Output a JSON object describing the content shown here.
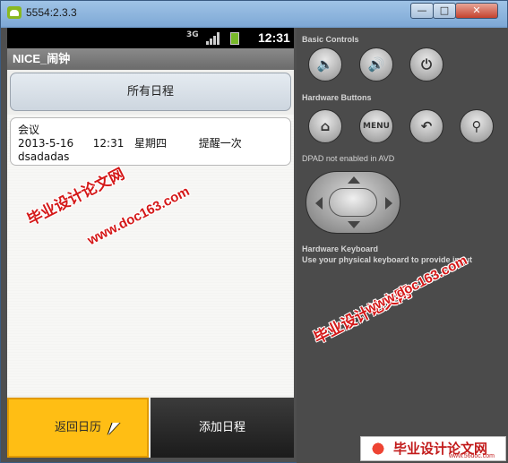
{
  "window": {
    "title": "5554:2.3.3",
    "min_glyph": "—",
    "max_glyph": "□",
    "close_glyph": "✕"
  },
  "status_bar": {
    "network": "3G",
    "time": "12:31"
  },
  "app": {
    "title": "NICE_闹钟",
    "all_schedules_button": "所有日程",
    "schedule_items": [
      {
        "title": "会议",
        "date": "2013-5-16",
        "time": "12:31",
        "weekday": "星期四",
        "reminder": "提醒一次",
        "note": "dsadadas"
      }
    ],
    "back_to_calendar_button": "返回日历",
    "add_schedule_button": "添加日程"
  },
  "controls": {
    "basic_controls_label": "Basic Controls",
    "hardware_buttons_label": "Hardware Buttons",
    "menu_label": "MENU",
    "dpad_note": "DPAD not enabled in AVD",
    "keyboard_label": "Hardware Keyboard",
    "keyboard_note": "Use your physical keyboard to provide input"
  },
  "watermarks": {
    "cn": "毕业设计论文网",
    "url": "www.doc163.com",
    "corner_cn": "毕业设计论文网",
    "corner_url": "www.56doc.com"
  }
}
